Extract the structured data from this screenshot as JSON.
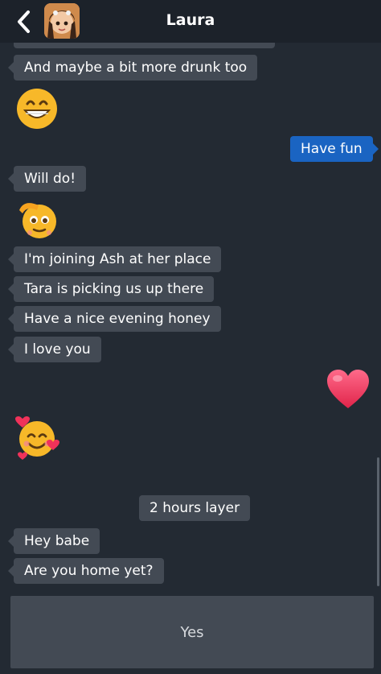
{
  "header": {
    "title": "Laura",
    "back_icon": "chevron-left-icon",
    "avatar_icon": "avatar-image"
  },
  "messages": [
    {
      "type": "incoming",
      "text": "And maybe a bit more drunk too"
    },
    {
      "type": "incoming-emoji",
      "emoji": "grinning-face-icon"
    },
    {
      "type": "outgoing",
      "text": "Have fun"
    },
    {
      "type": "incoming",
      "text": "Will do!"
    },
    {
      "type": "incoming-emoji",
      "emoji": "saluting-face-icon"
    },
    {
      "type": "incoming",
      "text": "I'm joining Ash at her place"
    },
    {
      "type": "incoming",
      "text": "Tara is picking us up there"
    },
    {
      "type": "incoming",
      "text": "Have a nice evening honey"
    },
    {
      "type": "incoming",
      "text": "I love you"
    },
    {
      "type": "outgoing-emoji",
      "emoji": "red-heart-icon"
    },
    {
      "type": "incoming-emoji",
      "emoji": "smiling-face-with-hearts-icon"
    },
    {
      "type": "timestamp",
      "text": "2 hours layer"
    },
    {
      "type": "incoming",
      "text": "Hey babe"
    },
    {
      "type": "incoming",
      "text": "Are you home yet?"
    }
  ],
  "reply": {
    "label": "Yes"
  },
  "colors": {
    "background": "#232a33",
    "header": "#1c222a",
    "incoming_bubble": "#434a54",
    "outgoing_bubble": "#1a64c2"
  }
}
